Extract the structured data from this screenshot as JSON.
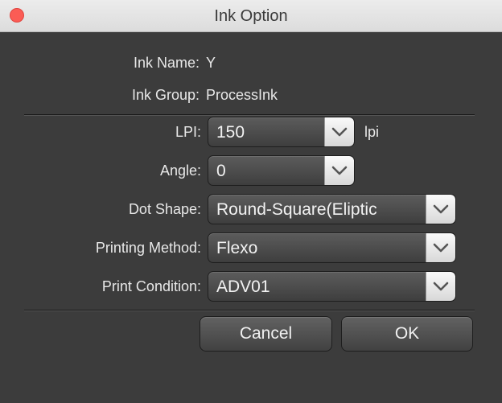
{
  "window": {
    "title": "Ink Option"
  },
  "info": {
    "ink_name_label": "Ink Name:",
    "ink_name_value": "Y",
    "ink_group_label": "Ink Group:",
    "ink_group_value": "ProcessInk"
  },
  "form": {
    "lpi": {
      "label": "LPI:",
      "value": "150",
      "unit": "lpi"
    },
    "angle": {
      "label": "Angle:",
      "value": "0"
    },
    "dot_shape": {
      "label": "Dot Shape:",
      "value": "Round-Square(Eliptic"
    },
    "printing_method": {
      "label": "Printing Method:",
      "value": "Flexo"
    },
    "print_condition": {
      "label": "Print Condition:",
      "value": "ADV01"
    }
  },
  "buttons": {
    "cancel": "Cancel",
    "ok": "OK"
  },
  "colors": {
    "background": "#3c3c3c",
    "titlebar": "#e4e4e4",
    "close_button": "#fb5c55",
    "text": "#e8e8e8"
  }
}
